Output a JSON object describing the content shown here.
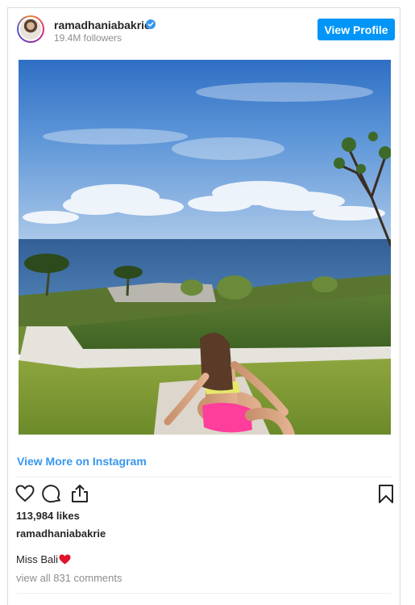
{
  "header": {
    "username": "ramadhaniabakrie",
    "followers": "19.4M followers",
    "view_profile_label": "View Profile"
  },
  "post": {
    "view_more_label": "View More on Instagram",
    "likes": "113,984 likes",
    "owner": "ramadhaniabakrie",
    "caption": "Miss Bali",
    "comments_link": "view all 831 comments"
  },
  "icons": {
    "verified": "verified-badge-icon",
    "like": "heart-outline-icon",
    "comment": "comment-bubble-icon",
    "share": "share-icon",
    "save": "bookmark-icon",
    "caption_emoji": "red-heart-emoji"
  },
  "colors": {
    "accent": "#0095f6",
    "link": "#3897f0",
    "text": "#262626",
    "muted": "#8e8e8e",
    "emoji_heart": "#e0142a"
  }
}
